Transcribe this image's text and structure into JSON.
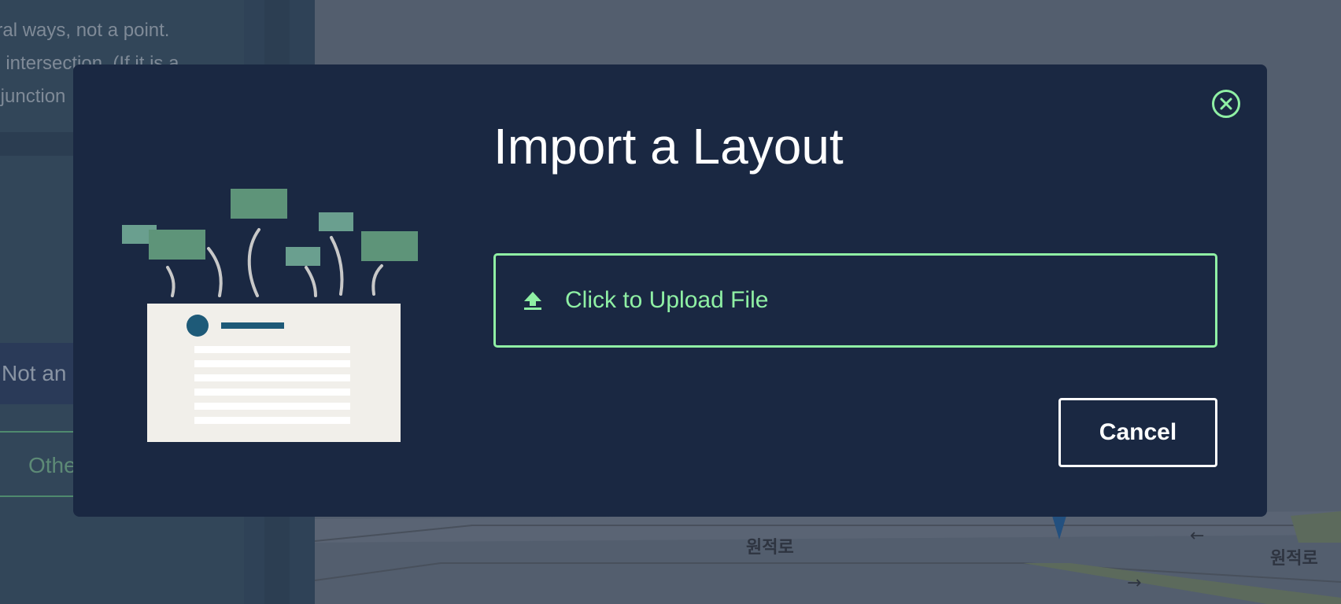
{
  "background": {
    "sidebar_text": [
      "eral ways, not a point.",
      "al intersection. (If it is a",
      "it junction"
    ],
    "not_an_label": "Not an",
    "other_label": "Othe",
    "map_labels": [
      "원적로",
      "원적로"
    ]
  },
  "modal": {
    "title": "Import a Layout",
    "upload_label": "Click to Upload File",
    "cancel_label": "Cancel",
    "close_icon": "close-circle-icon",
    "upload_icon": "upload-arrow-icon",
    "accent_color": "#8ff0a4",
    "background_color": "#1a2842"
  }
}
